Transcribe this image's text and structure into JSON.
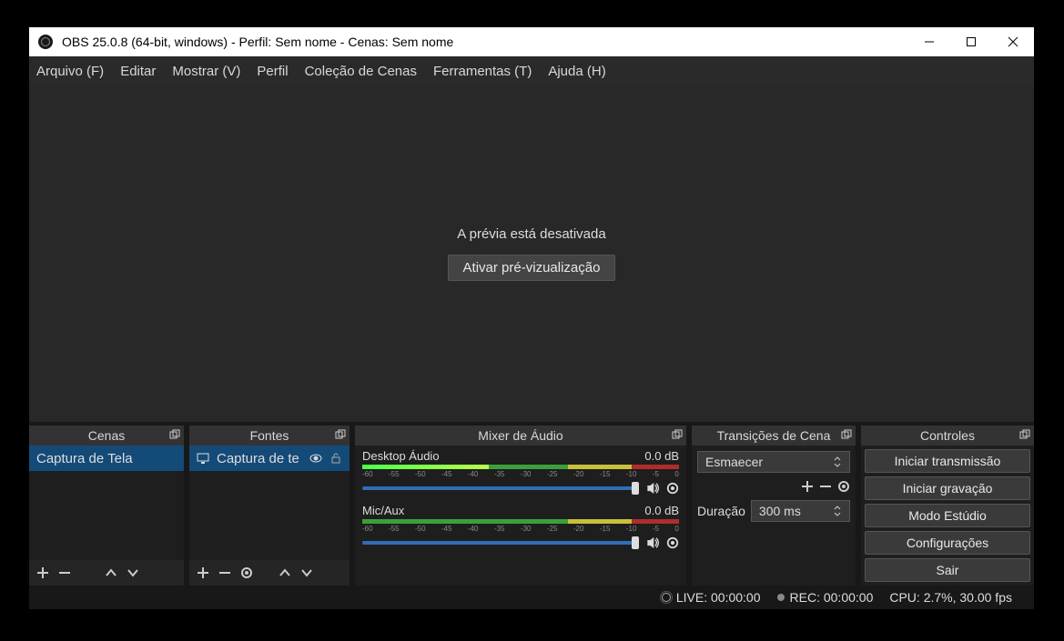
{
  "titlebar": {
    "title": "OBS 25.0.8 (64-bit, windows) - Perfil: Sem nome - Cenas: Sem nome"
  },
  "menu": {
    "items": [
      "Arquivo (F)",
      "Editar",
      "Mostrar (V)",
      "Perfil",
      "Coleção de Cenas",
      "Ferramentas (T)",
      "Ajuda (H)"
    ]
  },
  "preview": {
    "message": "A prévia está desativada",
    "button": "Ativar pré-vizualização"
  },
  "scenes": {
    "title": "Cenas",
    "items": [
      "Captura de Tela"
    ]
  },
  "sources": {
    "title": "Fontes",
    "items": [
      {
        "label": "Captura de te",
        "icon": "monitor"
      }
    ]
  },
  "mixer": {
    "title": "Mixer de Áudio",
    "channels": [
      {
        "name": "Desktop Áudio",
        "db": "0.0 dB"
      },
      {
        "name": "Mic/Aux",
        "db": "0.0 dB"
      }
    ],
    "ticks": [
      "-60",
      "-55",
      "-50",
      "-45",
      "-40",
      "-35",
      "-30",
      "-25",
      "-20",
      "-15",
      "-10",
      "-5",
      "0"
    ]
  },
  "transitions": {
    "title": "Transições de Cena",
    "selected": "Esmaecer",
    "duration_label": "Duração",
    "duration_value": "300 ms"
  },
  "controls": {
    "title": "Controles",
    "buttons": [
      "Iniciar transmissão",
      "Iniciar gravação",
      "Modo Estúdio",
      "Configurações",
      "Sair"
    ]
  },
  "status": {
    "live": "LIVE: 00:00:00",
    "rec": "REC: 00:00:00",
    "cpu": "CPU: 2.7%, 30.00 fps"
  }
}
